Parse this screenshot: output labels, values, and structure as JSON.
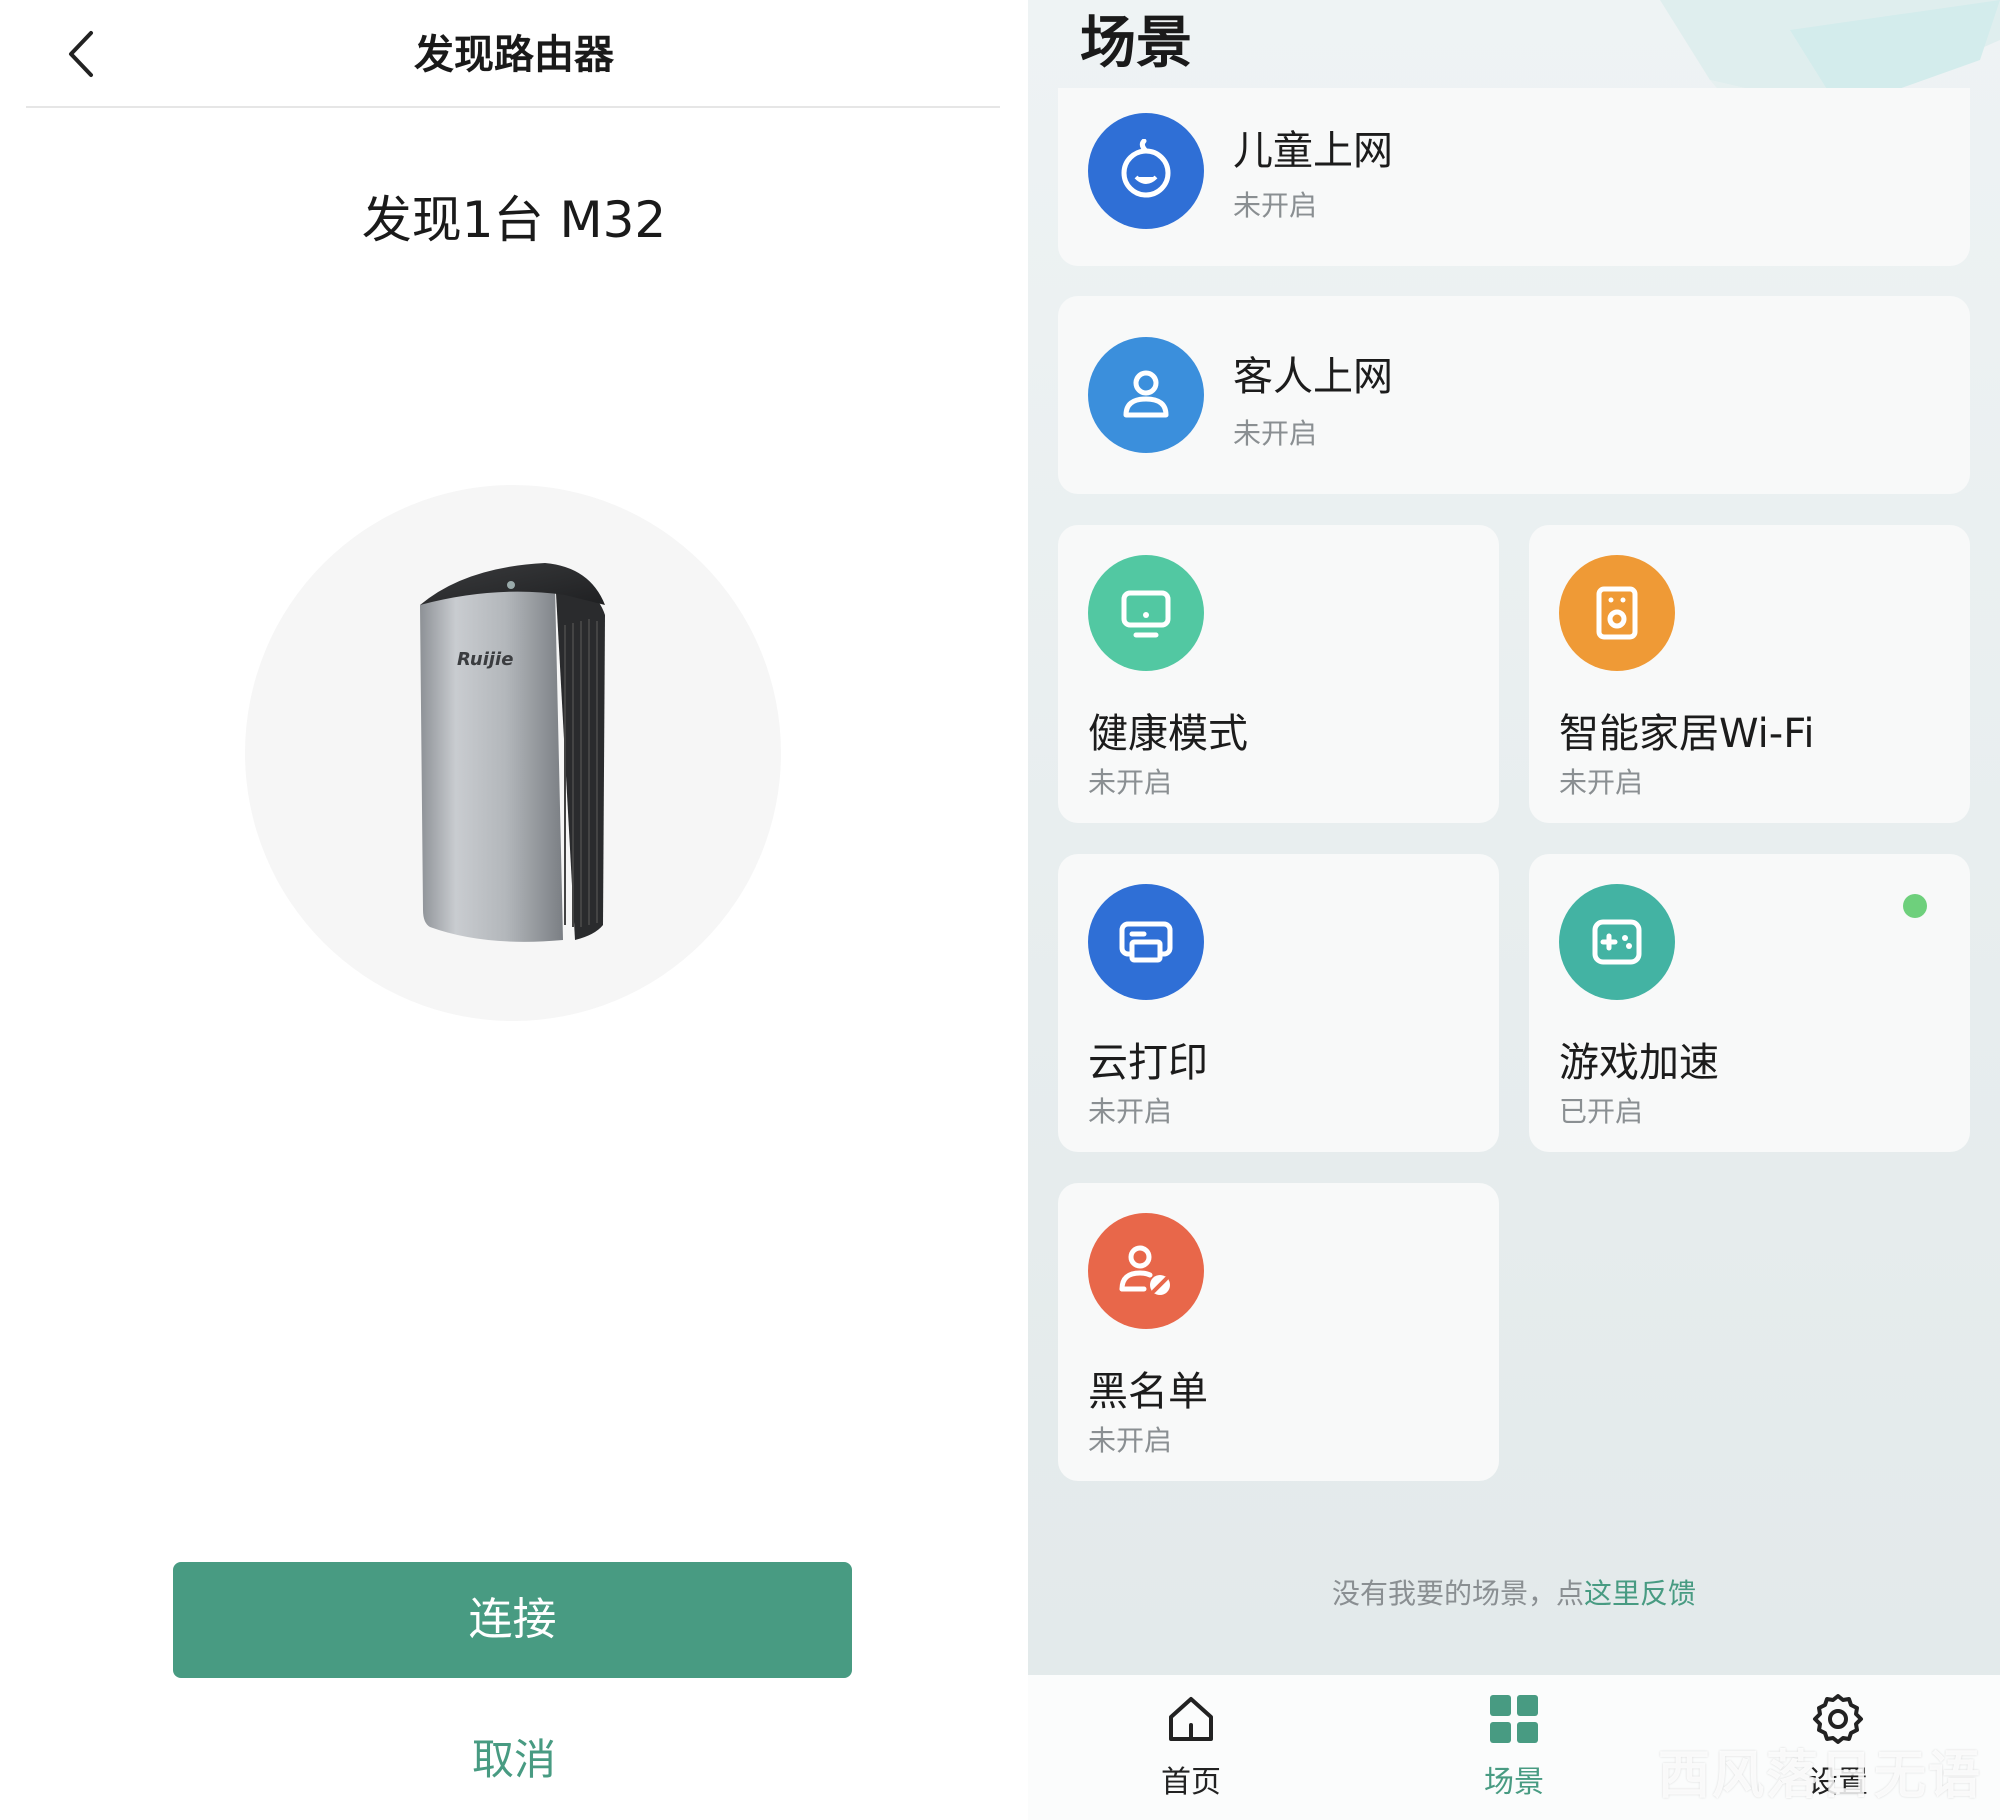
{
  "discover": {
    "nav_title": "发现路由器",
    "found_text": "发现1台 M32",
    "device_brand": "Ruijie",
    "connect_label": "连接",
    "cancel_label": "取消"
  },
  "scene": {
    "title": "场景",
    "cards": [
      {
        "name": "儿童上网",
        "status": "未开启",
        "icon": "child-face-icon",
        "color": "#2f6fd6"
      },
      {
        "name": "客人上网",
        "status": "未开启",
        "icon": "guest-user-icon",
        "color": "#3b8fdc"
      },
      {
        "name": "健康模式",
        "status": "未开启",
        "icon": "monitor-icon",
        "color": "#52c8a2"
      },
      {
        "name": "智能家居Wi-Fi",
        "status": "未开启",
        "icon": "speaker-icon",
        "color": "#ef9a36"
      },
      {
        "name": "云打印",
        "status": "未开启",
        "icon": "printer-icon",
        "color": "#2f6fd6"
      },
      {
        "name": "游戏加速",
        "status": "已开启",
        "icon": "gamepad-icon",
        "color": "#43b3a3"
      },
      {
        "name": "黑名单",
        "status": "未开启",
        "icon": "block-user-icon",
        "color": "#e8674a"
      }
    ],
    "feedback_prefix": "没有我要的场景，点",
    "feedback_link": "这里反馈",
    "tabs": [
      {
        "label": "首页",
        "icon": "home-icon"
      },
      {
        "label": "场景",
        "icon": "grid-icon"
      },
      {
        "label": "设置",
        "icon": "gear-icon"
      }
    ],
    "accent_color": "#489b82",
    "active_indicator_color": "#6ed07c"
  },
  "watermark": "西风落日无语"
}
